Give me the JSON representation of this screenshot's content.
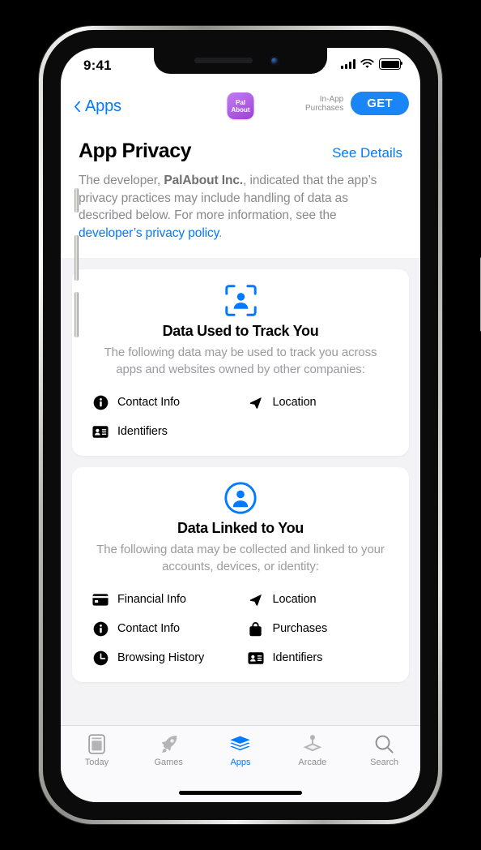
{
  "status_bar": {
    "time": "9:41",
    "signal_icon": "cellular-signal-icon",
    "wifi_icon": "wifi-icon",
    "battery_icon": "battery-icon"
  },
  "nav": {
    "back_label": "Apps",
    "back_icon": "chevron-left-icon",
    "app_icon_line1": "Pal",
    "app_icon_line2": "About",
    "in_app_purchases_line1": "In-App",
    "in_app_purchases_line2": "Purchases",
    "get_label": "GET"
  },
  "header": {
    "title": "App Privacy",
    "see_details": "See Details",
    "body_part1": "The developer, ",
    "body_developer": "PalAbout Inc.",
    "body_part2": ", indicated that the app’s privacy practices may include handling of data as described below. For more information, see the ",
    "body_link": "developer’s privacy policy",
    "body_part3": "."
  },
  "cards": [
    {
      "icon": "face-tracking-icon",
      "title": "Data Used to Track You",
      "subtitle": "The following data may be used to track you across apps and websites owned by other companies:",
      "items": [
        {
          "icon": "info-circle-icon",
          "label": "Contact Info"
        },
        {
          "icon": "location-arrow-icon",
          "label": "Location"
        },
        {
          "icon": "identification-card-icon",
          "label": "Identifiers"
        }
      ]
    },
    {
      "icon": "person-circle-icon",
      "title": "Data Linked to You",
      "subtitle": "The following data may be collected and linked to your accounts, devices, or identity:",
      "items": [
        {
          "icon": "credit-card-icon",
          "label": "Financial Info"
        },
        {
          "icon": "location-arrow-icon",
          "label": "Location"
        },
        {
          "icon": "info-circle-icon",
          "label": "Contact Info"
        },
        {
          "icon": "shopping-bag-icon",
          "label": "Purchases"
        },
        {
          "icon": "clock-icon",
          "label": "Browsing History"
        },
        {
          "icon": "identification-card-icon",
          "label": "Identifiers"
        }
      ]
    }
  ],
  "tabs": [
    {
      "icon": "today-document-icon",
      "label": "Today",
      "active": false
    },
    {
      "icon": "rocket-icon",
      "label": "Games",
      "active": false
    },
    {
      "icon": "stacked-layers-icon",
      "label": "Apps",
      "active": true
    },
    {
      "icon": "joystick-icon",
      "label": "Arcade",
      "active": false
    },
    {
      "icon": "magnifier-icon",
      "label": "Search",
      "active": false
    }
  ],
  "colors": {
    "accent_blue": "#007aff",
    "get_button_blue": "#1a85f7",
    "app_icon_purple": "#a84ee0",
    "page_background": "#f3f3f5",
    "secondary_text": "#8e8e93"
  }
}
